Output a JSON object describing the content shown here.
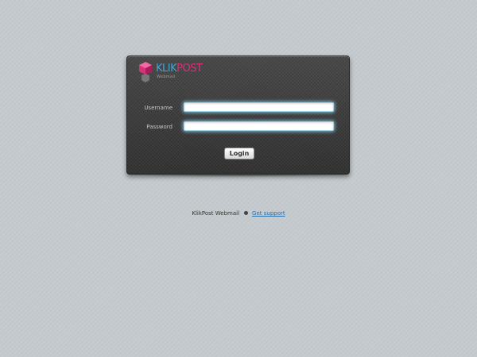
{
  "login": {
    "logo": {
      "brand_part1": "KLIK",
      "brand_part2": "POST",
      "tagline": "Webmail"
    },
    "username_label": "Username",
    "password_label": "Password",
    "username_value": "",
    "password_value": "",
    "login_button": "Login"
  },
  "footer": {
    "app_name": "KlikPost Webmail",
    "support_link": "Get support"
  },
  "colors": {
    "background": "#c4cacd",
    "panel": "#3f3f3f",
    "brand_blue": "#3fa3d8",
    "brand_pink": "#d9307a",
    "input_glow": "#87d2f0",
    "link": "#2a6fb0"
  }
}
